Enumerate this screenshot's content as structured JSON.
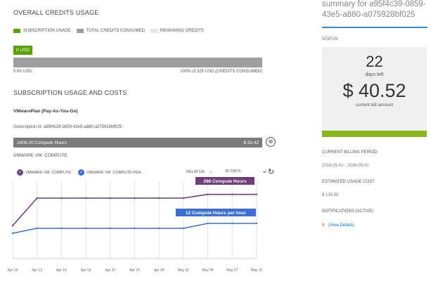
{
  "colors": {
    "subscription": "#57a300",
    "consumed": "#9e9e9e",
    "remaining": "#e6e6e6",
    "purple": "#6f3d7e",
    "blue": "#3b6fd8",
    "link": "#0072c6",
    "alert": "#d9342b"
  },
  "overall": {
    "title": "OVERALL CREDITS USAGE",
    "legend": [
      "SUBSCRIPTION USAGE",
      "TOTAL CREDITS CONSUMED",
      "REMAINING CREDITS"
    ],
    "usd_badge": "0 USD",
    "left_label": "0.00 USD",
    "right_label": "100% of 325 USD (CREDITS CONSUMED)",
    "consumed_fraction": 1.0
  },
  "subscription": {
    "title": "SUBSCRIPTION USAGE AND COSTS",
    "plan": "VMwarePlan (Pay-As-You-Go)",
    "subscription_id": "Subscription Id: a95f4c39-0859-43e5-a880-a075928bf025",
    "bar_left": "2406.00 Compute Hours",
    "bar_right": "$ 33.42",
    "meter": "VMWARE VM: COMPUTE"
  },
  "chart_controls": {
    "legend_a": "VMWARE VM: COMPUTE",
    "legend_b": "VMWARE VM: COMPUTE PER...",
    "relative": "RELATIVE",
    "range": "30 DAYS"
  },
  "chart_data": {
    "type": "line",
    "x": [
      "Apr 10",
      "Apr 13",
      "Apr 16",
      "Apr 19",
      "Apr 22",
      "Apr 25",
      "Apr 28",
      "May 01",
      "May 04",
      "May 07",
      "May 10"
    ],
    "series": [
      {
        "name": "VMWARE VM: COMPUTE",
        "values": [
          200,
          288,
          288,
          288,
          288,
          288,
          288,
          288,
          300,
          300,
          300
        ]
      },
      {
        "name": "VMWARE VM: COMPUTE PER...",
        "values": [
          4,
          8,
          8,
          8,
          8,
          8,
          8,
          8,
          12,
          12,
          12
        ]
      }
    ],
    "annotations": [
      "288 Compute Hours",
      "12 Compute Hours per hour"
    ],
    "grid": true
  },
  "right": {
    "summary_line1": "summary for a95f4c39-0859-",
    "summary_line2": "43e5-a880-a075928bf025",
    "status_label": "STATUS",
    "days_value": "22",
    "days_label": "days left",
    "bill_value": "$ 40.52",
    "bill_label": "current bill amount",
    "period_label": "CURRENT BILLING PERIOD",
    "period_value": "2016-05-01 - 2016-05-31",
    "est_label": "ESTIMATED USAGE COST",
    "est_value": "$ 139.58",
    "notif_label": "NOTIFICATIONS (ACTIVE)",
    "notif_count": "3",
    "notif_link": "(View Details)"
  }
}
